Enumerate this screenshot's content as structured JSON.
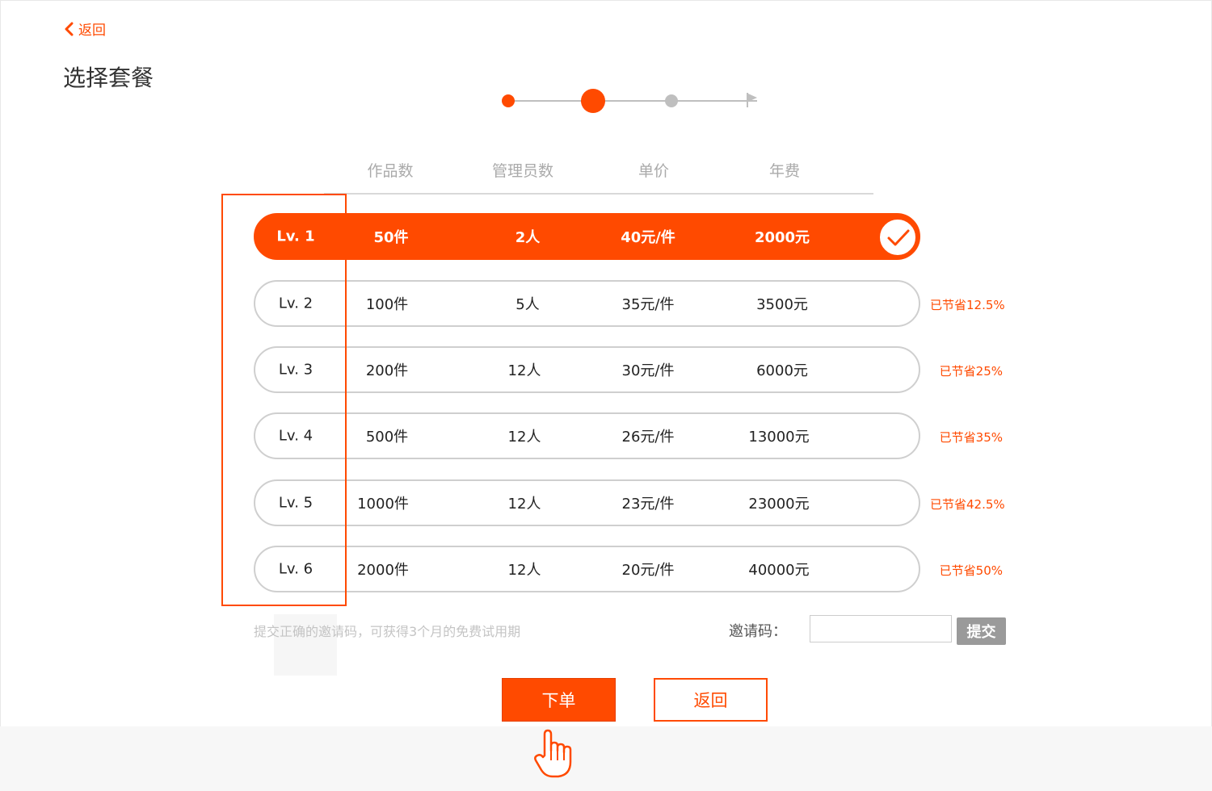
{
  "colors": {
    "accent": "#ff4a00",
    "muted": "#bfbfbf",
    "text": "#222222"
  },
  "header": {
    "back_label": "返回",
    "title": "选择套餐"
  },
  "steps": {
    "current": 2,
    "total": 3
  },
  "table": {
    "columns": [
      "作品数",
      "管理员数",
      "单价",
      "年费"
    ],
    "plans": [
      {
        "level": "Lv. 1",
        "works": "50件",
        "admins": "2人",
        "unit_price": "40元/件",
        "annual_fee": "2000元",
        "saving": "",
        "selected": true
      },
      {
        "level": "Lv. 2",
        "works": "100件",
        "admins": "5人",
        "unit_price": "35元/件",
        "annual_fee": "3500元",
        "saving": "已节省12.5%",
        "selected": false
      },
      {
        "level": "Lv. 3",
        "works": "200件",
        "admins": "12人",
        "unit_price": "30元/件",
        "annual_fee": "6000元",
        "saving": "已节省25%",
        "selected": false
      },
      {
        "level": "Lv. 4",
        "works": "500件",
        "admins": "12人",
        "unit_price": "26元/件",
        "annual_fee": "13000元",
        "saving": "已节省35%",
        "selected": false
      },
      {
        "level": "Lv. 5",
        "works": "1000件",
        "admins": "12人",
        "unit_price": "23元/件",
        "annual_fee": "23000元",
        "saving": "已节省42.5%",
        "selected": false
      },
      {
        "level": "Lv. 6",
        "works": "2000件",
        "admins": "12人",
        "unit_price": "20元/件",
        "annual_fee": "40000元",
        "saving": "已节省50%",
        "selected": false
      }
    ]
  },
  "invite": {
    "hint": "提交正确的邀请码，可获得3个月的免费试用期",
    "label": "邀请码：",
    "value": "",
    "placeholder": "",
    "submit_label": "提交"
  },
  "actions": {
    "order_label": "下单",
    "back_label": "返回"
  },
  "icons": {
    "back": "chevron-left-icon",
    "check": "check-icon",
    "flag": "flag-icon",
    "cursor": "hand-pointer-icon"
  }
}
